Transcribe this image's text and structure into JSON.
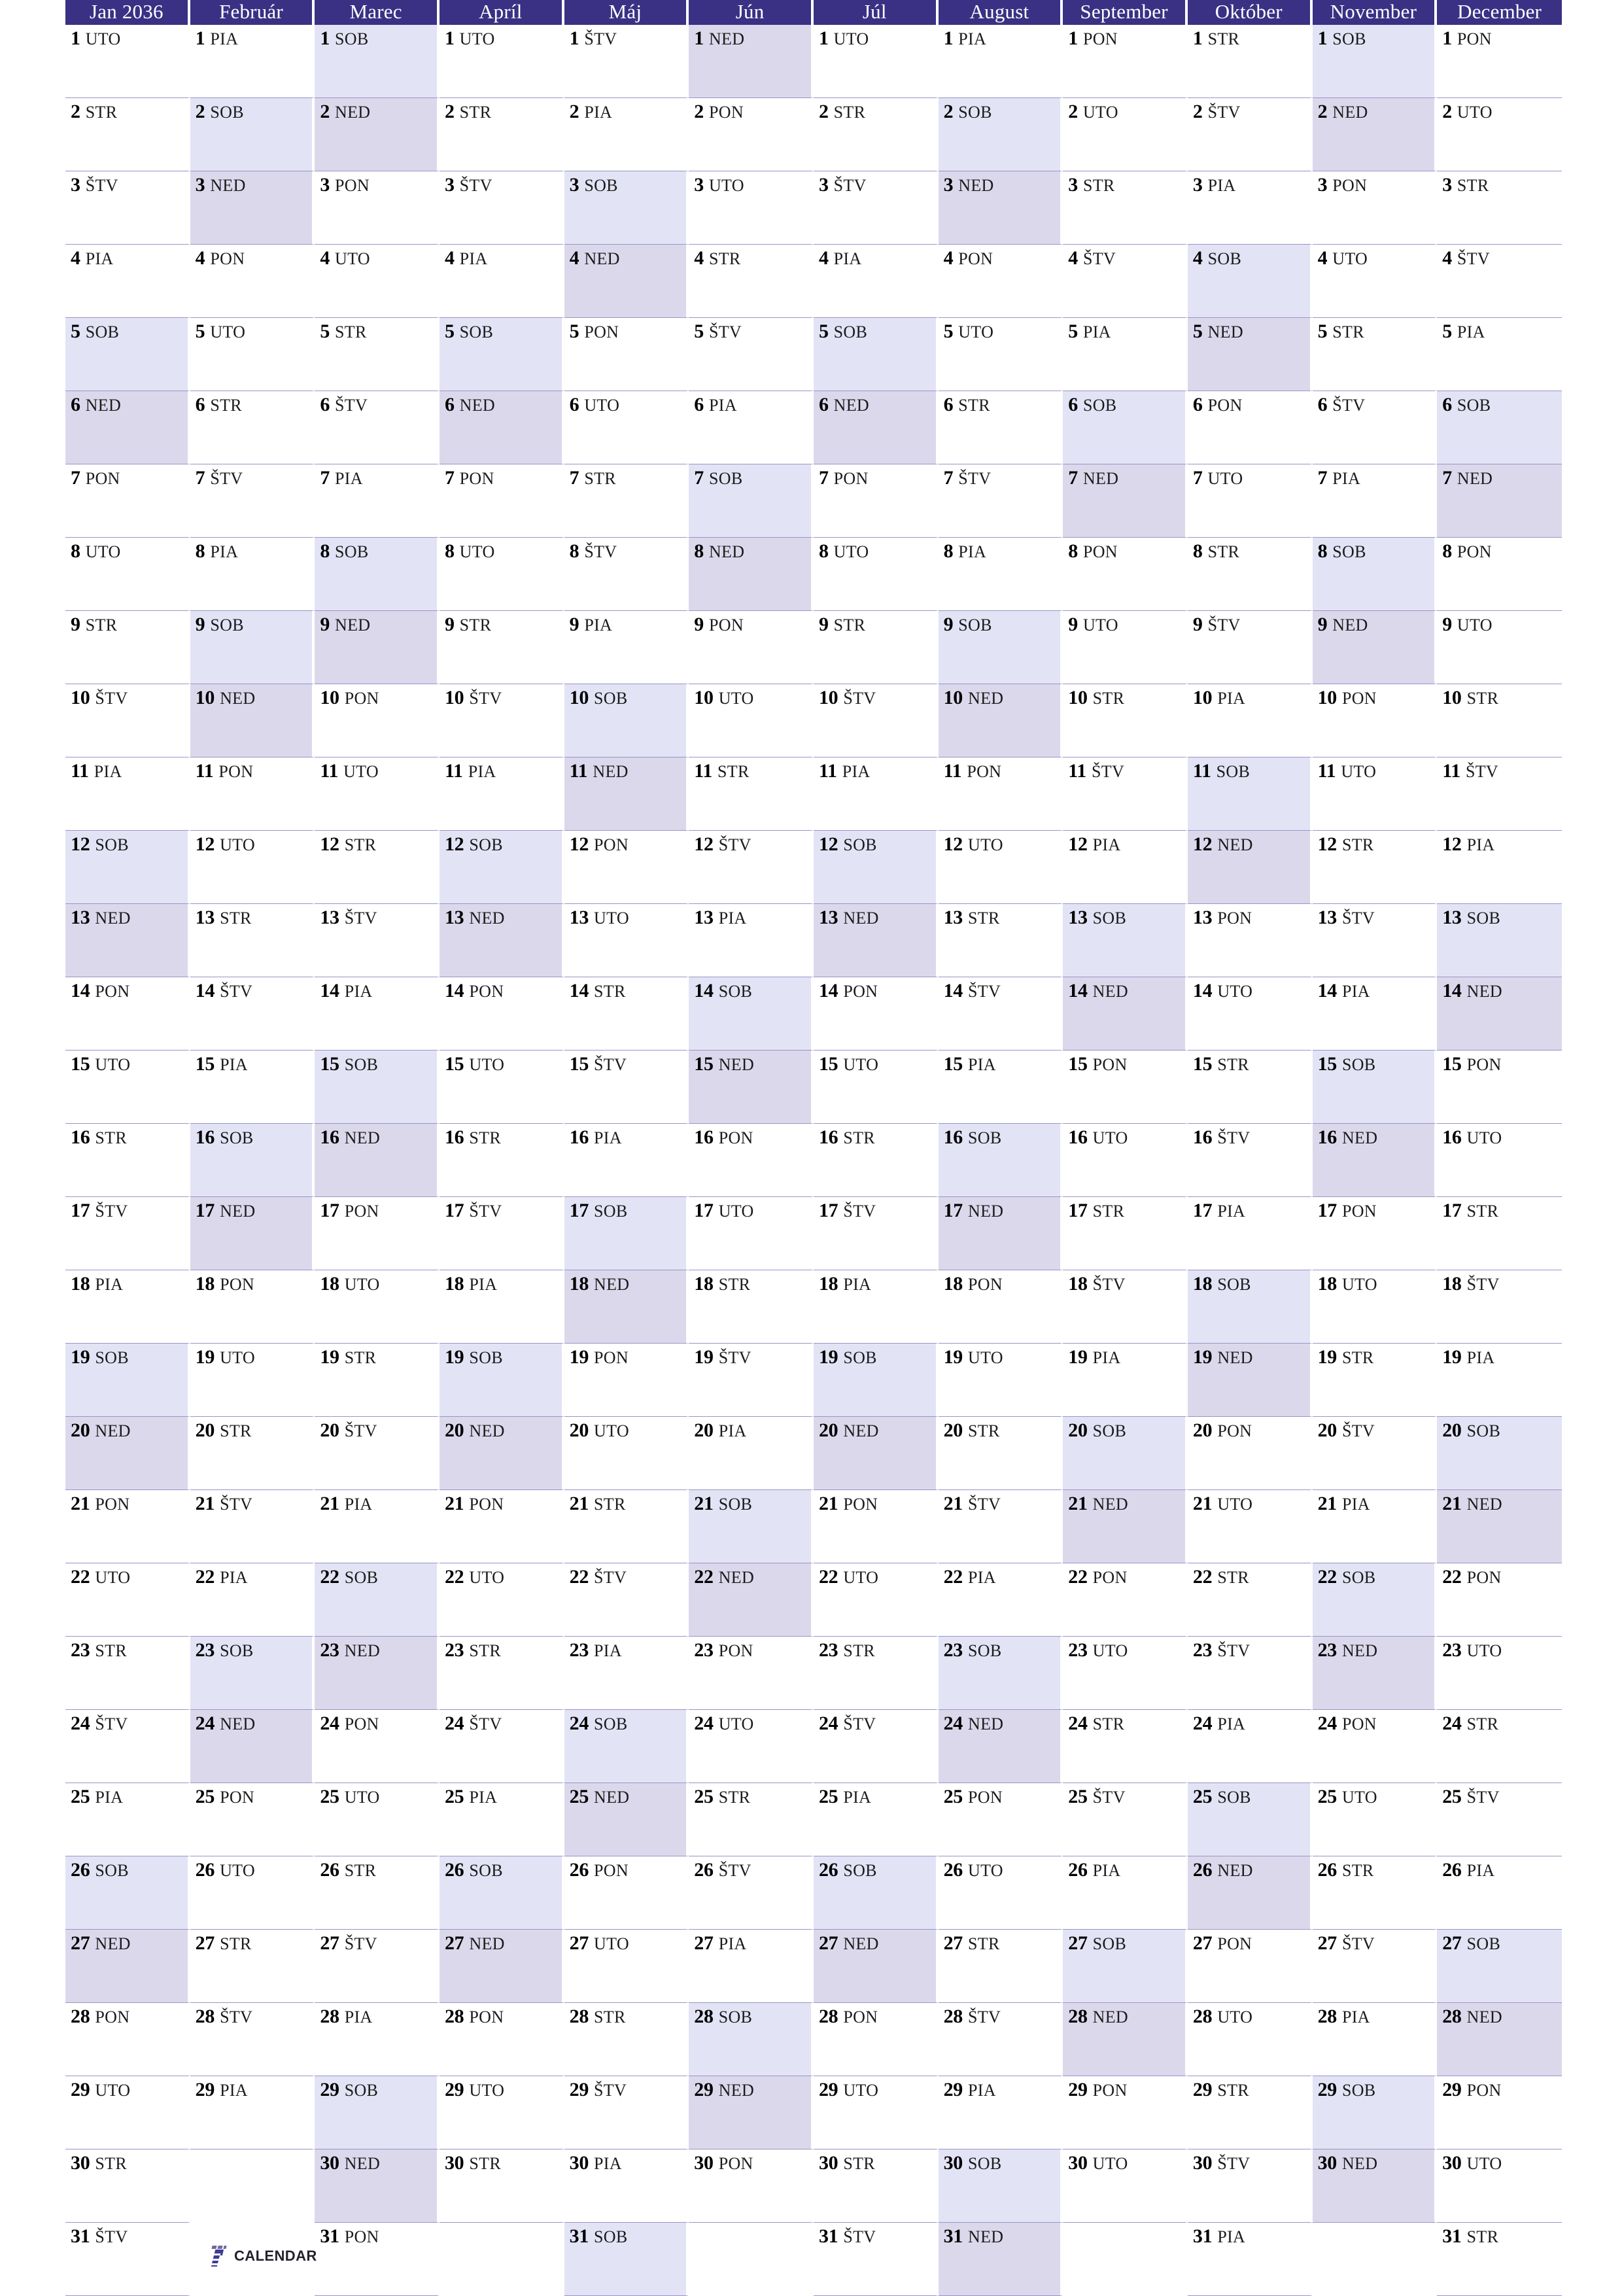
{
  "document": {
    "kind": "year-planner-calendar",
    "year_label": "2036",
    "language": "Slovak"
  },
  "colors": {
    "header_bg": "#3a3184",
    "header_text": "#ffffff",
    "saturday_bg": "#e3e3f6",
    "sunday_bg": "#dcd8ec",
    "weekday_bg": "#ffffff",
    "grid_line": "#9a94c4",
    "logo_accent": "#3f3a93"
  },
  "brand": {
    "mark": "seven-logo-icon",
    "wordmark": "CALENDAR"
  },
  "weekday_abbreviations": {
    "monday": "PON",
    "tuesday": "UTO",
    "wednesday": "STR",
    "thursday": "ŠTV",
    "friday": "PIA",
    "saturday": "SOB",
    "sunday": "NED"
  },
  "weekend_days": [
    "SOB",
    "NED"
  ],
  "day_numbers": [
    1,
    2,
    3,
    4,
    5,
    6,
    7,
    8,
    9,
    10,
    11,
    12,
    13,
    14,
    15,
    16,
    17,
    18,
    19,
    20,
    21,
    22,
    23,
    24,
    25,
    26,
    27,
    28,
    29,
    30,
    31
  ],
  "months": [
    {
      "index": 1,
      "header": "Jan 2036",
      "name": "Január",
      "days_in_month": 31,
      "weekdays": [
        "UTO",
        "STR",
        "ŠTV",
        "PIA",
        "SOB",
        "NED",
        "PON",
        "UTO",
        "STR",
        "ŠTV",
        "PIA",
        "SOB",
        "NED",
        "PON",
        "UTO",
        "STR",
        "ŠTV",
        "PIA",
        "SOB",
        "NED",
        "PON",
        "UTO",
        "STR",
        "ŠTV",
        "PIA",
        "SOB",
        "NED",
        "PON",
        "UTO",
        "STR",
        "ŠTV"
      ]
    },
    {
      "index": 2,
      "header": "Február",
      "name": "Február",
      "days_in_month": 29,
      "weekdays": [
        "PIA",
        "SOB",
        "NED",
        "PON",
        "UTO",
        "STR",
        "ŠTV",
        "PIA",
        "SOB",
        "NED",
        "PON",
        "UTO",
        "STR",
        "ŠTV",
        "PIA",
        "SOB",
        "NED",
        "PON",
        "UTO",
        "STR",
        "ŠTV",
        "PIA",
        "SOB",
        "NED",
        "PON",
        "UTO",
        "STR",
        "ŠTV",
        "PIA"
      ]
    },
    {
      "index": 3,
      "header": "Marec",
      "name": "Marec",
      "days_in_month": 31,
      "weekdays": [
        "SOB",
        "NED",
        "PON",
        "UTO",
        "STR",
        "ŠTV",
        "PIA",
        "SOB",
        "NED",
        "PON",
        "UTO",
        "STR",
        "ŠTV",
        "PIA",
        "SOB",
        "NED",
        "PON",
        "UTO",
        "STR",
        "ŠTV",
        "PIA",
        "SOB",
        "NED",
        "PON",
        "UTO",
        "STR",
        "ŠTV",
        "PIA",
        "SOB",
        "NED",
        "PON"
      ]
    },
    {
      "index": 4,
      "header": "Apríl",
      "name": "Apríl",
      "days_in_month": 30,
      "weekdays": [
        "UTO",
        "STR",
        "ŠTV",
        "PIA",
        "SOB",
        "NED",
        "PON",
        "UTO",
        "STR",
        "ŠTV",
        "PIA",
        "SOB",
        "NED",
        "PON",
        "UTO",
        "STR",
        "ŠTV",
        "PIA",
        "SOB",
        "NED",
        "PON",
        "UTO",
        "STR",
        "ŠTV",
        "PIA",
        "SOB",
        "NED",
        "PON",
        "UTO",
        "STR"
      ]
    },
    {
      "index": 5,
      "header": "Máj",
      "name": "Máj",
      "days_in_month": 31,
      "weekdays": [
        "ŠTV",
        "PIA",
        "SOB",
        "NED",
        "PON",
        "UTO",
        "STR",
        "ŠTV",
        "PIA",
        "SOB",
        "NED",
        "PON",
        "UTO",
        "STR",
        "ŠTV",
        "PIA",
        "SOB",
        "NED",
        "PON",
        "UTO",
        "STR",
        "ŠTV",
        "PIA",
        "SOB",
        "NED",
        "PON",
        "UTO",
        "STR",
        "ŠTV",
        "PIA",
        "SOB"
      ]
    },
    {
      "index": 6,
      "header": "Jún",
      "name": "Jún",
      "days_in_month": 30,
      "weekdays": [
        "NED",
        "PON",
        "UTO",
        "STR",
        "ŠTV",
        "PIA",
        "SOB",
        "NED",
        "PON",
        "UTO",
        "STR",
        "ŠTV",
        "PIA",
        "SOB",
        "NED",
        "PON",
        "UTO",
        "STR",
        "ŠTV",
        "PIA",
        "SOB",
        "NED",
        "PON",
        "UTO",
        "STR",
        "ŠTV",
        "PIA",
        "SOB",
        "NED",
        "PON"
      ]
    },
    {
      "index": 7,
      "header": "Júl",
      "name": "Júl",
      "days_in_month": 31,
      "weekdays": [
        "UTO",
        "STR",
        "ŠTV",
        "PIA",
        "SOB",
        "NED",
        "PON",
        "UTO",
        "STR",
        "ŠTV",
        "PIA",
        "SOB",
        "NED",
        "PON",
        "UTO",
        "STR",
        "ŠTV",
        "PIA",
        "SOB",
        "NED",
        "PON",
        "UTO",
        "STR",
        "ŠTV",
        "PIA",
        "SOB",
        "NED",
        "PON",
        "UTO",
        "STR",
        "ŠTV"
      ]
    },
    {
      "index": 8,
      "header": "August",
      "name": "August",
      "days_in_month": 31,
      "weekdays": [
        "PIA",
        "SOB",
        "NED",
        "PON",
        "UTO",
        "STR",
        "ŠTV",
        "PIA",
        "SOB",
        "NED",
        "PON",
        "UTO",
        "STR",
        "ŠTV",
        "PIA",
        "SOB",
        "NED",
        "PON",
        "UTO",
        "STR",
        "ŠTV",
        "PIA",
        "SOB",
        "NED",
        "PON",
        "UTO",
        "STR",
        "ŠTV",
        "PIA",
        "SOB",
        "NED"
      ]
    },
    {
      "index": 9,
      "header": "September",
      "name": "September",
      "days_in_month": 30,
      "weekdays": [
        "PON",
        "UTO",
        "STR",
        "ŠTV",
        "PIA",
        "SOB",
        "NED",
        "PON",
        "UTO",
        "STR",
        "ŠTV",
        "PIA",
        "SOB",
        "NED",
        "PON",
        "UTO",
        "STR",
        "ŠTV",
        "PIA",
        "SOB",
        "NED",
        "PON",
        "UTO",
        "STR",
        "ŠTV",
        "PIA",
        "SOB",
        "NED",
        "PON",
        "UTO"
      ]
    },
    {
      "index": 10,
      "header": "Október",
      "name": "Október",
      "days_in_month": 31,
      "weekdays": [
        "STR",
        "ŠTV",
        "PIA",
        "SOB",
        "NED",
        "PON",
        "UTO",
        "STR",
        "ŠTV",
        "PIA",
        "SOB",
        "NED",
        "PON",
        "UTO",
        "STR",
        "ŠTV",
        "PIA",
        "SOB",
        "NED",
        "PON",
        "UTO",
        "STR",
        "ŠTV",
        "PIA",
        "SOB",
        "NED",
        "PON",
        "UTO",
        "STR",
        "ŠTV",
        "PIA"
      ]
    },
    {
      "index": 11,
      "header": "November",
      "name": "November",
      "days_in_month": 30,
      "weekdays": [
        "SOB",
        "NED",
        "PON",
        "UTO",
        "STR",
        "ŠTV",
        "PIA",
        "SOB",
        "NED",
        "PON",
        "UTO",
        "STR",
        "ŠTV",
        "PIA",
        "SOB",
        "NED",
        "PON",
        "UTO",
        "STR",
        "ŠTV",
        "PIA",
        "SOB",
        "NED",
        "PON",
        "UTO",
        "STR",
        "ŠTV",
        "PIA",
        "SOB",
        "NED"
      ]
    },
    {
      "index": 12,
      "header": "December",
      "name": "December",
      "days_in_month": 31,
      "weekdays": [
        "PON",
        "UTO",
        "STR",
        "ŠTV",
        "PIA",
        "SOB",
        "NED",
        "PON",
        "UTO",
        "STR",
        "ŠTV",
        "PIA",
        "SOB",
        "NED",
        "PON",
        "UTO",
        "STR",
        "ŠTV",
        "PIA",
        "SOB",
        "NED",
        "PON",
        "UTO",
        "STR",
        "ŠTV",
        "PIA",
        "SOB",
        "NED",
        "PON",
        "UTO",
        "STR"
      ]
    }
  ]
}
